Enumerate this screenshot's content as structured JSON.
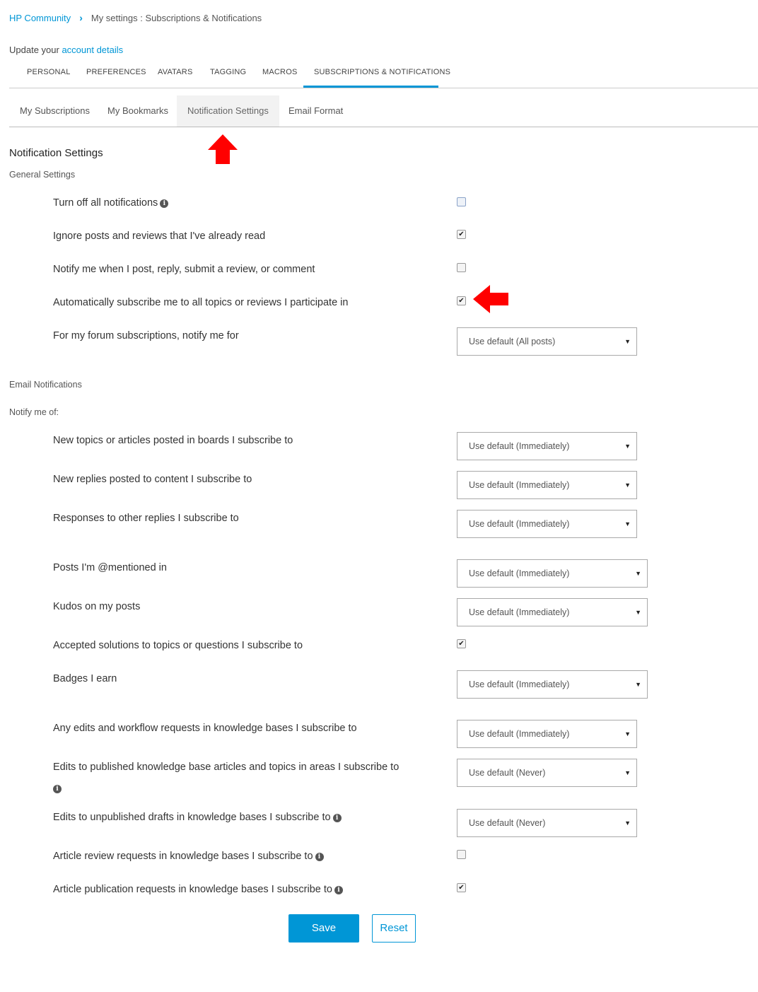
{
  "breadcrumb": {
    "home": "HP Community",
    "current": "My settings : Subscriptions & Notifications"
  },
  "update": {
    "prefix": "Update your ",
    "link": "account details"
  },
  "top_tabs": [
    "PERSONAL",
    "PREFERENCES",
    "AVATARS",
    "TAGGING",
    "MACROS",
    "SUBSCRIPTIONS & NOTIFICATIONS"
  ],
  "top_tab_active": "SUBSCRIPTIONS & NOTIFICATIONS",
  "sub_tabs": [
    "My Subscriptions",
    "My Bookmarks",
    "Notification Settings",
    "Email Format"
  ],
  "sub_tab_active": "Notification Settings",
  "section": {
    "title": "Notification Settings",
    "general": "General Settings",
    "email": "Email Notifications",
    "notify_me_of": "Notify me of:"
  },
  "general_settings": [
    {
      "label": "Turn off all notifications",
      "control": "checkbox",
      "checked": false,
      "info": true
    },
    {
      "label": "Ignore posts and reviews that I've already read",
      "control": "checkbox",
      "checked": true
    },
    {
      "label": "Notify me when I post, reply, submit a review, or comment",
      "control": "checkbox",
      "checked": false
    },
    {
      "label": "Automatically subscribe me to all topics or reviews I participate in",
      "control": "checkbox",
      "checked": true
    },
    {
      "label": "For my forum subscriptions, notify me for",
      "control": "select",
      "value": "Use default (All posts)"
    }
  ],
  "email_notifications": [
    {
      "label": "New topics or articles posted in boards I subscribe to",
      "control": "select",
      "value": "Use default (Immediately)"
    },
    {
      "label": "New replies posted to content I subscribe to",
      "control": "select",
      "value": "Use default (Immediately)"
    },
    {
      "label": "Responses to other replies I subscribe to",
      "control": "select",
      "value": "Use default (Immediately)"
    },
    {
      "label": "Posts I'm @mentioned in",
      "control": "select",
      "value": "Use default (Immediately)"
    },
    {
      "label": "Kudos on my posts",
      "control": "select",
      "value": "Use default (Immediately)"
    },
    {
      "label": "Accepted solutions to topics or questions I subscribe to",
      "control": "checkbox",
      "checked": true
    },
    {
      "label": "Badges I earn",
      "control": "select",
      "value": "Use default (Immediately)"
    },
    {
      "label": "Any edits and workflow requests in knowledge bases I subscribe to",
      "control": "select",
      "value": "Use default (Immediately)"
    },
    {
      "label": "Edits to published knowledge base articles and topics in areas I subscribe to",
      "control": "select",
      "value": "Use default (Never)",
      "info": true
    },
    {
      "label": "Edits to unpublished drafts in knowledge bases I subscribe to",
      "control": "select",
      "value": "Use default (Never)",
      "info": true
    },
    {
      "label": "Article review requests in knowledge bases I subscribe to",
      "control": "checkbox",
      "checked": false,
      "info": true
    },
    {
      "label": "Article publication requests in knowledge bases I subscribe to",
      "control": "checkbox",
      "checked": true,
      "info": true
    }
  ],
  "buttons": {
    "save": "Save",
    "reset": "Reset"
  },
  "icons": {
    "info": "info-icon",
    "caret": "caret-down-icon",
    "arrow_up": "red-arrow-up-icon",
    "arrow_left": "red-arrow-left-icon"
  },
  "colors": {
    "link": "#0096d6",
    "annotation_arrow": "#ff0000"
  }
}
